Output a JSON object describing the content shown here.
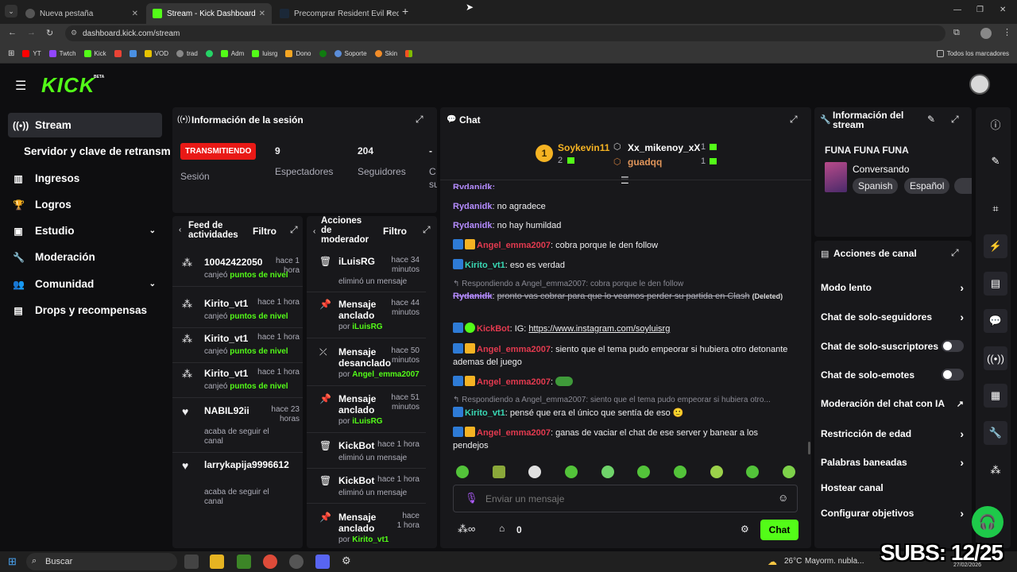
{
  "browser": {
    "tabs": [
      {
        "label": "Nueva pestaña",
        "active": false
      },
      {
        "label": "Stream - Kick Dashboard",
        "active": true
      },
      {
        "label": "Precomprar Resident Evil Requ",
        "active": false
      }
    ],
    "url": "dashboard.kick.com/stream",
    "bookmarks": [
      "YT",
      "Twtch",
      "Kick",
      "VOD",
      "trad",
      "Adm",
      "luisrg",
      "Dono",
      "Soporte",
      "Skin"
    ],
    "all_bookmarks": "Todos los marcadores"
  },
  "header": {
    "logo": "KICK",
    "beta": "BETA"
  },
  "sidebar": {
    "items": [
      {
        "label": "Stream",
        "icon": "broadcast-icon"
      },
      {
        "label": "Servidor y clave de retransm",
        "icon": ""
      },
      {
        "label": "Ingresos",
        "icon": "bar-chart-icon"
      },
      {
        "label": "Logros",
        "icon": "trophy-icon"
      },
      {
        "label": "Estudio",
        "icon": "studio-icon"
      },
      {
        "label": "Moderación",
        "icon": "wrench-icon"
      },
      {
        "label": "Comunidad",
        "icon": "people-icon"
      },
      {
        "label": "Drops y recompensas",
        "icon": "gift-icon"
      }
    ]
  },
  "session": {
    "title": "Información de la sesión",
    "status": "TRANSMITIENDO",
    "session_label": "Sesión",
    "viewers": "9",
    "viewers_label": "Espectadores",
    "followers": "204",
    "followers_label": "Seguidores",
    "extra_value": "-",
    "extra_label": "C",
    "extra_label2": "su"
  },
  "feed": {
    "title_line1": "Feed de",
    "title_line2": "actividades",
    "filter": "Filtro",
    "rows": [
      {
        "name": "10042422050",
        "time": "hace 1 hora",
        "pre": "canjeó ",
        "highlight": "puntos de nivel"
      },
      {
        "name": "Kirito_vt1",
        "time": "hace 1 hora",
        "pre": "canjeó ",
        "highlight": "puntos de nivel"
      },
      {
        "name": "Kirito_vt1",
        "time": "hace 1 hora",
        "pre": "canjeó ",
        "highlight": "puntos de nivel"
      },
      {
        "name": "Kirito_vt1",
        "time": "hace 1 hora",
        "pre": "canjeó ",
        "highlight": "puntos de nivel"
      },
      {
        "name": "NABIL92ii",
        "time": "hace 23 horas",
        "pre": "acaba de seguir el canal",
        "highlight": ""
      },
      {
        "name": "larrykapija9996612",
        "time": "",
        "pre": "acaba de seguir el canal",
        "highlight": ""
      }
    ]
  },
  "mod_actions": {
    "title_line1": "Acciones",
    "title_line2": "de",
    "title_line3": "moderador",
    "filter": "Filtro",
    "rows": [
      {
        "icon": "trash-icon",
        "name": "iLuisRG",
        "time": "hace 34 minutos",
        "pre": "eliminó un mensaje",
        "by": ""
      },
      {
        "icon": "pin-icon",
        "name": "Mensaje anclado",
        "time": "hace 44 minutos",
        "pre": "por ",
        "by": "iLuisRG"
      },
      {
        "icon": "unpin-icon",
        "name": "Mensaje desanclado",
        "time": "hace 50 minutos",
        "pre": "por ",
        "by": "Angel_emma2007"
      },
      {
        "icon": "pin-icon",
        "name": "Mensaje anclado",
        "time": "hace 51 minutos",
        "pre": "por ",
        "by": "iLuisRG"
      },
      {
        "icon": "trash-icon",
        "name": "KickBot",
        "time": "hace 1 hora",
        "pre": "eliminó un mensaje",
        "by": ""
      },
      {
        "icon": "trash-icon",
        "name": "KickBot",
        "time": "hace 1 hora",
        "pre": "eliminó un mensaje",
        "by": ""
      },
      {
        "icon": "pin-icon",
        "name": "Mensaje anclado",
        "time": "hace 1 hora",
        "pre": "por ",
        "by": "Kirito_vt1"
      }
    ]
  },
  "chat": {
    "title": "Chat",
    "leaderboard": [
      {
        "rank": "1",
        "name": "Soykevin11",
        "count": "2"
      },
      {
        "rank": "",
        "name": "Xx_mikenoy_xX",
        "count": "1"
      },
      {
        "rank": "",
        "name": "guadqq",
        "count": "1"
      }
    ],
    "partial_user": "Rydanidk:",
    "messages": [
      {
        "user": "Rydanidk",
        "color": "purple",
        "badges": 0,
        "text": "no agradece"
      },
      {
        "user": "Rydanidk",
        "color": "purple",
        "badges": 0,
        "text": "no hay humildad"
      },
      {
        "user": "Angel_emma2007",
        "color": "red",
        "badges": 2,
        "text": "cobra porque le den follow"
      },
      {
        "user": "Kirito_vt1",
        "color": "teal",
        "badges": 1,
        "text": "eso es verdad"
      }
    ],
    "reply1": "Respondiendo a Angel_emma2007: cobra porque le den follow",
    "deleted": {
      "user": "Rydanidk",
      "text": "pronto vas cobrar para que lo veamos perder su partida en Clash",
      "tag": "(Deleted)"
    },
    "kickbot": {
      "user": "KickBot",
      "pre": "IG: ",
      "link": "https://www.instagram.com/soyluisrg"
    },
    "msg_long": {
      "user": "Angel_emma2007",
      "text": "siento que el tema pudo empeorar si hubiera otro detonante ademas del juego"
    },
    "msg_emote_user": "Angel_emma2007",
    "reply2": "Respondiendo a Angel_emma2007: siento que el tema pudo empeorar si hubiera otro...",
    "msg_kirito2": {
      "user": "Kirito_vt1",
      "text": "pensé que era el único que sentía de eso 🙂"
    },
    "msg_last": {
      "user": "Angel_emma2007",
      "text": "ganas de vaciar el chat de ese server y banear a los pendejos"
    },
    "input_placeholder": "Enviar un mensaje",
    "points": "0",
    "send": "Chat"
  },
  "stream_info": {
    "title_line1": "Información del",
    "title_line2": "stream",
    "stream_title": "FUNA FUNA FUNA",
    "category": "Conversando",
    "tags": [
      "Spanish",
      "Español"
    ]
  },
  "channel_actions": {
    "title": "Acciones de canal",
    "rows": [
      {
        "label": "Modo lento",
        "control": "chevron"
      },
      {
        "label": "Chat de solo-seguidores",
        "control": "chevron"
      },
      {
        "label": "Chat de solo-suscriptores",
        "control": "toggle"
      },
      {
        "label": "Chat de solo-emotes",
        "control": "toggle"
      },
      {
        "label": "Moderación del chat con IA",
        "control": "external"
      },
      {
        "label": "Restricción de edad",
        "control": "chevron"
      },
      {
        "label": "Palabras baneadas",
        "control": "chevron"
      },
      {
        "label": "Hostear canal",
        "control": "none"
      },
      {
        "label": "Configurar objetivos",
        "control": "chevron"
      }
    ]
  },
  "overlay": {
    "subs": "SUBS: 12/25"
  },
  "taskbar": {
    "search": "Buscar",
    "weather": "26°C",
    "weather_text": "Mayorm. nubla...",
    "date": "27/02/2026"
  },
  "colors": {
    "accent": "#53fc18",
    "live": "#e91916",
    "panel": "#18181b"
  }
}
